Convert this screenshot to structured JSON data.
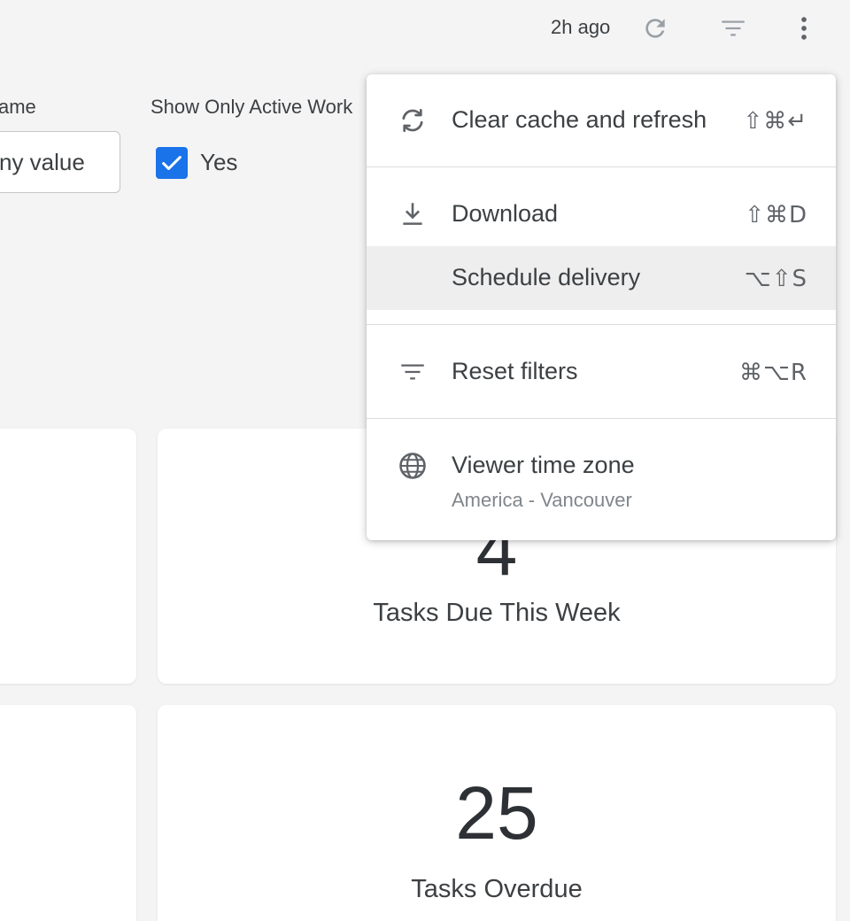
{
  "topbar": {
    "last_updated": "2h ago",
    "refresh_icon": "refresh-icon",
    "filter_icon": "filter-icon",
    "more_icon": "more-vert-icon"
  },
  "filters": {
    "name": {
      "label": "ame",
      "value": "ny value"
    },
    "active_workers": {
      "label": "Show Only Active Work",
      "checkbox_checked": true,
      "checkbox_label": "Yes"
    }
  },
  "cards": [
    {
      "value": "4",
      "label": "Tasks Due This Week"
    },
    {
      "value": "25",
      "label": "Tasks Overdue"
    }
  ],
  "menu": {
    "items": [
      {
        "icon": "sync-icon",
        "label": "Clear cache and refresh",
        "shortcut": "⇧⌘↵"
      },
      {
        "icon": "download-icon",
        "label": "Download",
        "shortcut": "⇧⌘D"
      },
      {
        "icon": "",
        "label": "Schedule delivery",
        "shortcut": "⌥⇧S",
        "highlighted": true
      },
      {
        "icon": "filter-icon",
        "label": "Reset filters",
        "shortcut": "⌘⌥R"
      },
      {
        "icon": "globe-icon",
        "label": "Viewer time zone",
        "sublabel": "America - Vancouver"
      }
    ]
  },
  "colors": {
    "accent": "#1a73e8",
    "background": "#f4f4f5",
    "highlight": "#eeeeee",
    "text": "#3c4043"
  }
}
